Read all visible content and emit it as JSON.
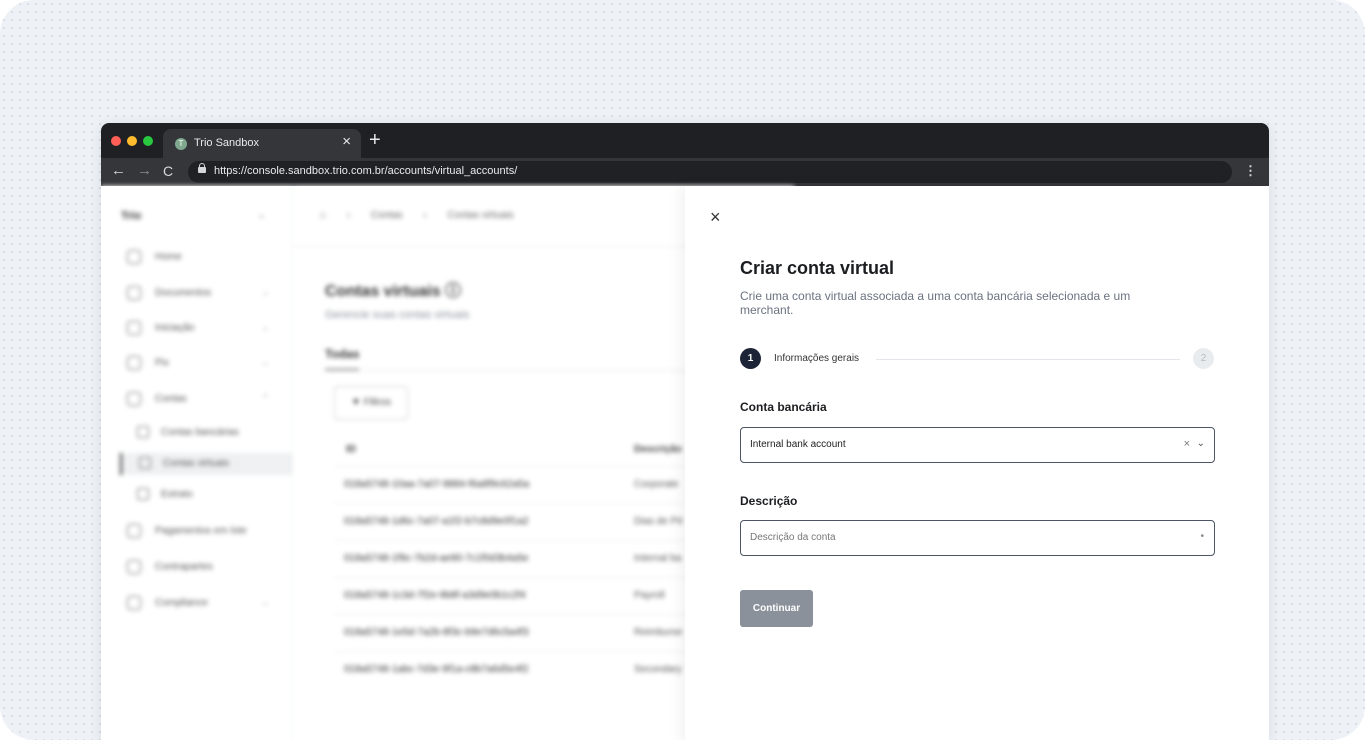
{
  "browser": {
    "tab_title": "Trio Sandbox",
    "tab_favicon": "T",
    "tab_close": "×",
    "new_tab": "+",
    "url": "https://console.sandbox.trio.com.br/accounts/virtual_accounts/",
    "nav_back": "←",
    "nav_forward": "→",
    "nav_reload": "C",
    "menu": "⋮"
  },
  "sidebar": {
    "org": "Trio",
    "items": [
      {
        "label": "Home",
        "icon": "home-icon"
      },
      {
        "label": "Documentos",
        "icon": "document-icon"
      },
      {
        "label": "Iniciação",
        "icon": "plus-icon"
      },
      {
        "label": "Pix",
        "icon": "pix-icon"
      },
      {
        "label": "Contas",
        "icon": "bank-icon"
      },
      {
        "label": "Pagamentos em lote",
        "icon": "batch-icon"
      },
      {
        "label": "Contrapartes",
        "icon": "users-icon"
      },
      {
        "label": "Compliance",
        "icon": "shield-icon"
      }
    ],
    "subitems": [
      {
        "label": "Contas bancárias",
        "icon": "bank-account-icon"
      },
      {
        "label": "Contas virtuais",
        "icon": "virtual-account-icon"
      },
      {
        "label": "Extrato",
        "icon": "statement-icon"
      }
    ]
  },
  "main": {
    "breadcrumb": [
      "Contas",
      "Contas virtuais"
    ],
    "title": "Contas virtuais",
    "subtitle": "Gerencie suas contas virtuais",
    "tab": "Todas",
    "filter": "Filtros",
    "columns": [
      "ID",
      "Descrição"
    ],
    "rows": [
      {
        "id": "018a5748-10aa-7a07-9884-f6a8f9c62a5a",
        "desc": "Corporate"
      },
      {
        "id": "018a5748-1d6c-7a07-a1f2-b7c8d9e0f1a2",
        "desc": "Dias de Pé"
      },
      {
        "id": "018a5748-1f9c-7b2d-ae90-7c1f0d3b4a5e",
        "desc": "Internal ba"
      },
      {
        "id": "018a5748-1c3d-7f2e-9b8f-a3d9e0b1c2f4",
        "desc": "Payroll"
      },
      {
        "id": "018a5748-1e5d-7a2b-8f3c-b9e7d6c5a4f3",
        "desc": "Reimburse"
      },
      {
        "id": "018a5748-1abc-7d3e-9f1a-c8b7a6d5e4f2",
        "desc": "Secondary"
      }
    ]
  },
  "drawer": {
    "close": "×",
    "title": "Criar conta virtual",
    "subtitle": "Crie uma conta virtual associada a uma conta bancária selecionada e um merchant.",
    "step1_number": "1",
    "step1_label": "Informações gerais",
    "step2_number": "2",
    "bank_label": "Conta bancária",
    "bank_value": "Internal bank account",
    "bank_clear": "×",
    "bank_chevron": "⌄",
    "desc_label": "Descrição",
    "desc_placeholder": "Descrição da conta",
    "desc_mark": "•",
    "continue": "Continuar"
  }
}
